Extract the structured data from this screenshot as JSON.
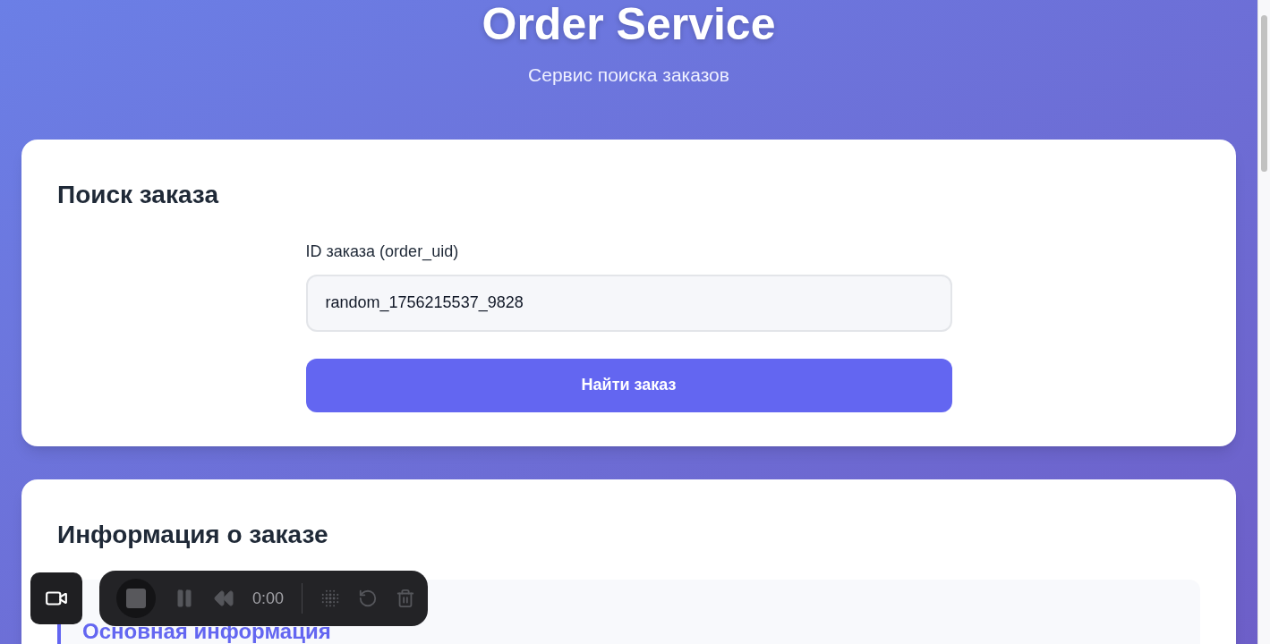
{
  "header": {
    "title": "Order Service",
    "subtitle": "Сервис поиска заказов"
  },
  "search_card": {
    "title": "Поиск заказа",
    "field": {
      "label": "ID заказа (order_uid)",
      "value": "random_1756215537_9828"
    },
    "button": "Найти заказ"
  },
  "order_card": {
    "title": "Информация о заказе",
    "sections": [
      {
        "title": "Основная информация"
      }
    ]
  },
  "recorder": {
    "time": "0:00",
    "controls": [
      {
        "kind": "stop",
        "disabled": false
      },
      {
        "kind": "pause",
        "disabled": true
      },
      {
        "kind": "rewind",
        "disabled": true
      },
      {
        "kind": "time",
        "disabled": false
      },
      {
        "kind": "divider",
        "disabled": false
      },
      {
        "kind": "dots",
        "disabled": true
      },
      {
        "kind": "restart",
        "disabled": true
      },
      {
        "kind": "trash",
        "disabled": true
      }
    ]
  }
}
